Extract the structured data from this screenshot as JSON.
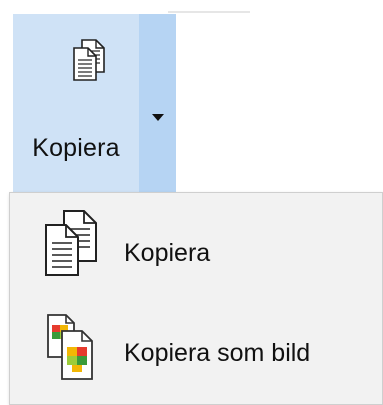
{
  "split_button": {
    "label": "Kopiera",
    "icon": "copy-icon",
    "arrow_icon": "caret-down-icon"
  },
  "menu": {
    "items": [
      {
        "label": "Kopiera",
        "icon": "copy-icon"
      },
      {
        "label": "Kopiera som bild",
        "icon": "copy-as-picture-icon"
      }
    ]
  },
  "colors": {
    "split_main_bg": "#cfe2f6",
    "split_arrow_bg": "#b6d4f3",
    "menu_bg": "#f2f2f2"
  }
}
